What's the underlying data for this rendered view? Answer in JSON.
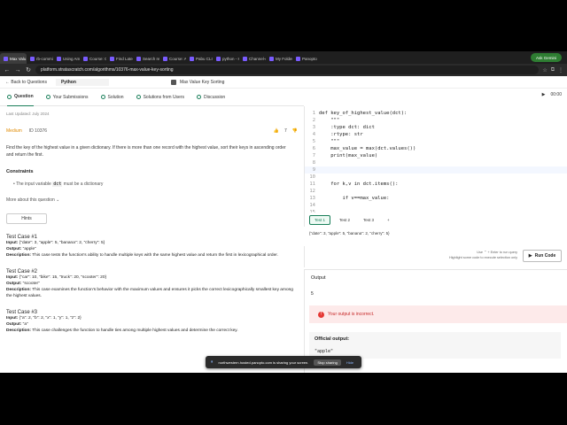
{
  "browser": {
    "tabs": [
      {
        "label": "Max Valu",
        "active": true
      },
      {
        "label": "rb-commis-c",
        "active": false
      },
      {
        "label": "Using Amazo",
        "active": false
      },
      {
        "label": "Course: Comp",
        "active": false
      },
      {
        "label": "Find Latest Sc",
        "active": false
      },
      {
        "label": "Search results",
        "active": false
      },
      {
        "label": "Course: Amazo",
        "active": false
      },
      {
        "label": "Pabu CLI — Te",
        "active": false
      },
      {
        "label": "python - How",
        "active": false
      },
      {
        "label": "Channel-comm",
        "active": false
      },
      {
        "label": "My Folder : Pa",
        "active": false
      },
      {
        "label": "Panopto",
        "active": false
      }
    ],
    "profile": "Ask Gemini",
    "url": "platform.stratascratch.com/algorithms/10376-max-value-key-sorting"
  },
  "app": {
    "back": "← Back to Questions",
    "language": "Python",
    "current_tab_title": "Max Value Key Sorting"
  },
  "subtabs": [
    "Question",
    "Your Submissions",
    "Solution",
    "Solutions from Users",
    "Discussion"
  ],
  "timer": "00:00",
  "question": {
    "last_updated": "Last Updated: July 2024",
    "difficulty": "Medium",
    "id": "ID 10376",
    "upvotes": "7",
    "description": "Find the key of the highest value in a given dictionary. If there is more than one record with the highest value, sort their keys in ascending order and return the first.",
    "constraints_title": "Constraints",
    "constraint": "The input variable",
    "constraint_code": "dct",
    "constraint_tail": "must be a dictionary",
    "more": "More about this question ⌄",
    "hints": "Hints",
    "test_cases": [
      {
        "title": "Test Case #1",
        "input": "{\"date\": 3, \"apple\": 5, \"banana\": 2, \"cherry\": 5}",
        "output": "\"apple\"",
        "description": "This case tests the function's ability to handle multiple keys with the same highest value and return the first in lexicographical order."
      },
      {
        "title": "Test Case #2",
        "input": "{\"car\": 10, \"bike\": 15, \"truck\": 20, \"scooter\": 20}",
        "output": "\"scooter\"",
        "description": "This case examines the function's behavior with the maximum values and ensures it picks the correct lexicographically smallest key among the highest values."
      },
      {
        "title": "Test Case #3",
        "input": "{\"a\": 2, \"b\": 2, \"x\": 1, \"y\": 1, \"z\": 2}",
        "output": "\"a\"",
        "description": "This case challenges the function to handle ties among multiple highest values and determine the correct key."
      }
    ],
    "labels": {
      "input": "Input:",
      "output": "Output:",
      "description": "Description:"
    }
  },
  "editor": {
    "lines": [
      {
        "n": "1",
        "code": "def key_of_highest_value(dct):"
      },
      {
        "n": "2",
        "code": "    \"\"\""
      },
      {
        "n": "3",
        "code": "    :type dct: dict"
      },
      {
        "n": "4",
        "code": "    :rtype: str"
      },
      {
        "n": "5",
        "code": "    \"\"\""
      },
      {
        "n": "6",
        "code": "    max_value = max(dct.values())"
      },
      {
        "n": "7",
        "code": "    print(max_value)"
      },
      {
        "n": "8",
        "code": ""
      },
      {
        "n": "9",
        "code": ""
      },
      {
        "n": "10",
        "code": ""
      },
      {
        "n": "11",
        "code": "    for k,v in dct.items():"
      },
      {
        "n": "12",
        "code": ""
      },
      {
        "n": "13",
        "code": "        if v==max_value:"
      },
      {
        "n": "14",
        "code": ""
      },
      {
        "n": "15",
        "code": ""
      }
    ]
  },
  "tests": {
    "tabs": [
      "Test 1",
      "Test 2",
      "Test 3",
      "+"
    ],
    "input": "{\"date\": 3, \"apple\": 5, \"banana\": 2, \"cherry\": 5}"
  },
  "run": {
    "hint_line1": "Use ⌃ + Enter to run query",
    "hint_line2": "Highlight some code to execute selection only",
    "label": "Run Code"
  },
  "output": {
    "title": "Output",
    "value": "5",
    "error": "Your output is incorrect.",
    "official_label": "Official output:",
    "official_value": "\"apple\""
  },
  "share": {
    "text": "northwestern.hosted.panopto.com is sharing your screen.",
    "stop": "Stop sharing",
    "hide": "Hide"
  },
  "colors": {
    "accent": "#1a7f5a",
    "error": "#c62828",
    "difficulty": "#e08a00"
  }
}
